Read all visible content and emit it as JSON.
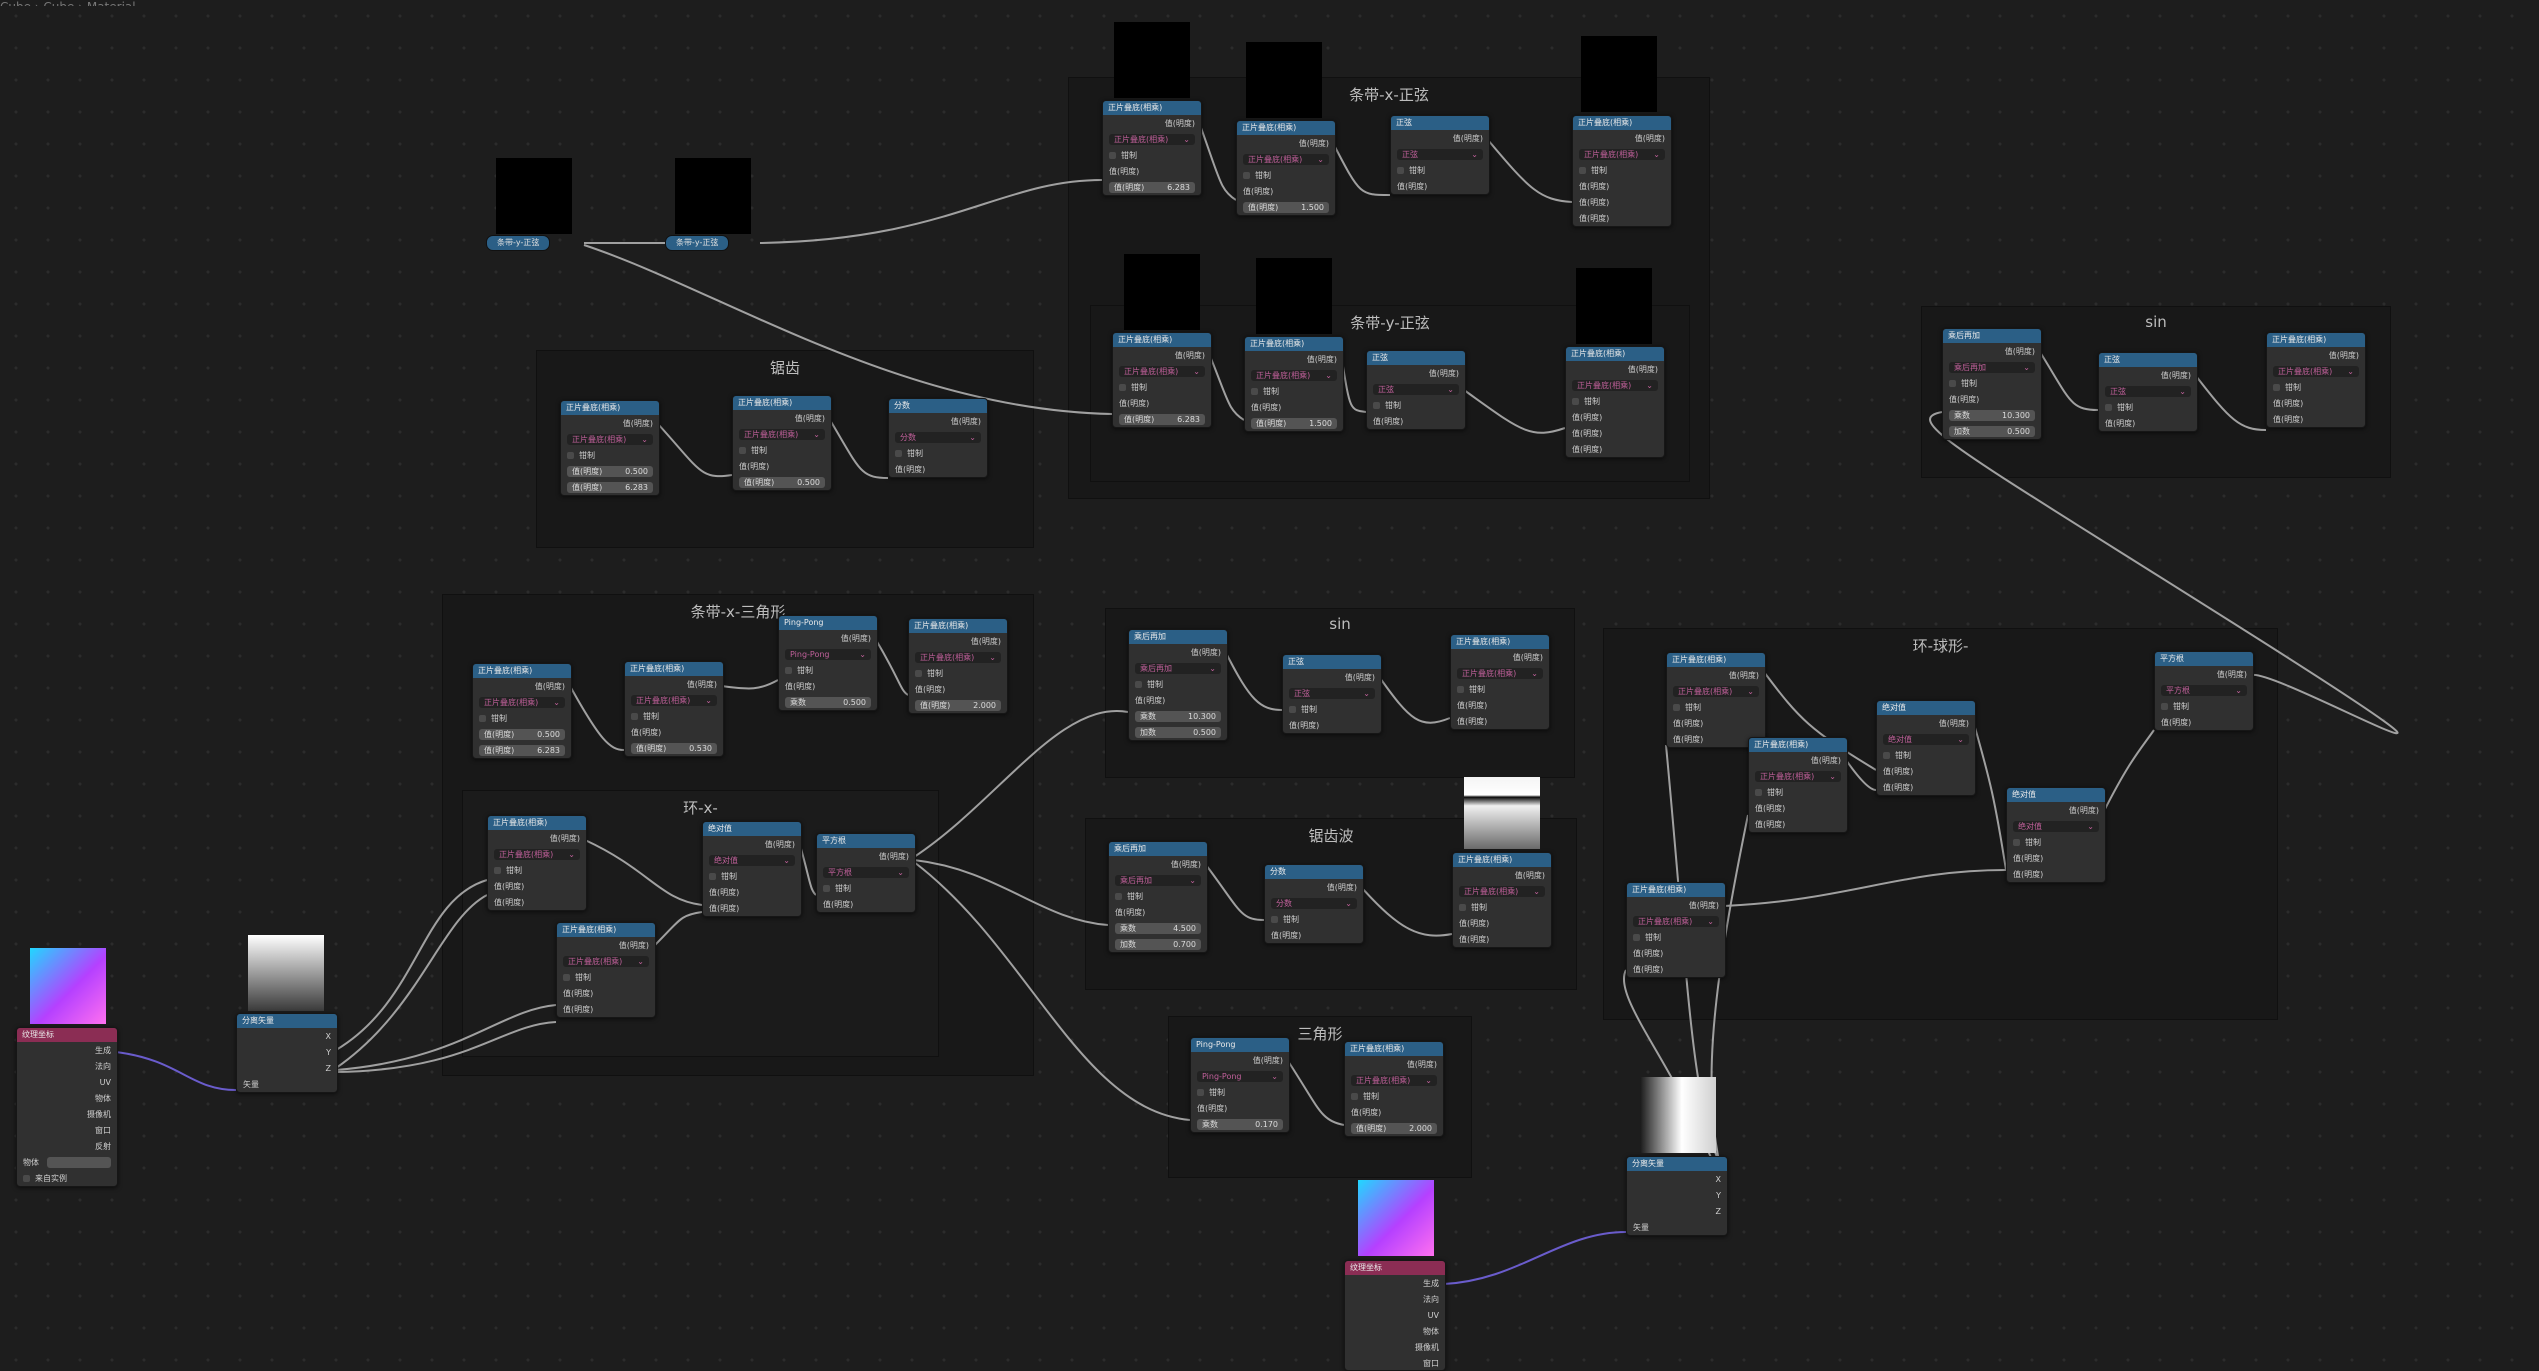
{
  "breadcrumb": [
    "Cube",
    "Cube",
    "Material"
  ],
  "frames": {
    "stripe_x_sin": "条带-x-正弦",
    "stripe_y_sin": "条带-y-正弦",
    "sawtooth": "锯齿",
    "sin_right": "sin",
    "stripe_x_triangle": "条带-x-三角形",
    "ring_x": "环-x-",
    "sin_mid": "sin",
    "sawtooth_wave": "锯齿波",
    "triangle": "三角形",
    "ring_sphere": "环-球形-"
  },
  "nodes": {
    "multiply_add": "正片叠底(相乘)",
    "sine": "正弦",
    "modulo": "分数",
    "pingpong": "Ping-Pong",
    "absolute": "绝对值",
    "power": "平方根",
    "wrapped": "乘后再加",
    "separate_xyz": "分离矢量",
    "tex_coord": "纹理坐标",
    "val": "值(明度)",
    "clamp": "钳制",
    "scale_label": "乘数",
    "add_label": "加数"
  },
  "reroutes": [
    "条带-y-正弦",
    "条带-y-正弦"
  ],
  "values": {
    "v6283": "6.283",
    "v1500": "1.500",
    "v0500": "0.500",
    "v10300": "10.300",
    "v2000": "2.000",
    "v4500": "4.500",
    "v0700": "0.700",
    "v0170": "0.170",
    "v0530": "0.530"
  },
  "texcoord_outputs": [
    "生成",
    "法向",
    "UV",
    "物体",
    "摄像机",
    "窗口",
    "反射"
  ],
  "texcoord_object_label": "物体",
  "texcoord_instancer": "来自实例",
  "xyz": [
    "X",
    "Y",
    "Z"
  ],
  "vector_label": "矢量",
  "colors": {
    "node_header_math": "#2b5f86",
    "node_header_texcoord": "#8b2d54",
    "background": "#1d1d1d",
    "frame": "#181818",
    "vector_link": "#6a5ccc"
  }
}
